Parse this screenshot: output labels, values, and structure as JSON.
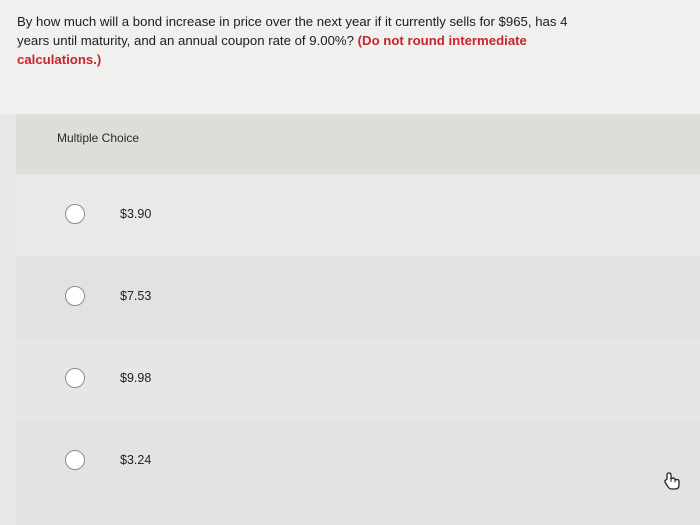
{
  "question": {
    "text": "By how much will a bond increase in price over the next year if it currently sells for $965, has 4 years until maturity, and an annual coupon rate of 9.00%? ",
    "note": "(Do not round intermediate calculations.)",
    "note_color": "#c8252c"
  },
  "multiple_choice": {
    "title": "Multiple Choice",
    "options": [
      {
        "label": "$3.90"
      },
      {
        "label": "$7.53"
      },
      {
        "label": "$9.98"
      },
      {
        "label": "$3.24"
      }
    ]
  },
  "cursor": {
    "icon": "hand-pointer-icon"
  }
}
